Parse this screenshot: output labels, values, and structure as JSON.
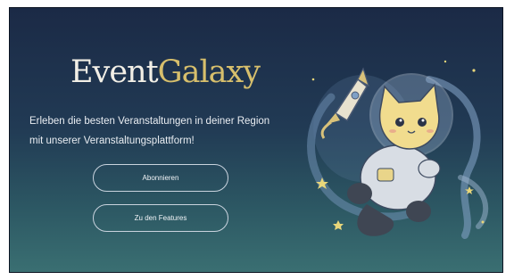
{
  "brand": {
    "word1": "Event",
    "word2": "Galaxy"
  },
  "hero": {
    "tagline_line1": "Erleben die besten Veranstaltungen in deiner Region",
    "tagline_line2": "mit unserer Veranstaltungsplattform!"
  },
  "buttons": {
    "subscribe_label": "Abonnieren",
    "features_label": "Zu den Features"
  },
  "icons": {
    "illustration": "astronaut-cat-with-rocket-illustration"
  },
  "colors": {
    "background_top": "#1b2a46",
    "background_bottom": "#3a6f72",
    "brand_accent": "#d7bf6c",
    "text": "#e9edf2"
  }
}
